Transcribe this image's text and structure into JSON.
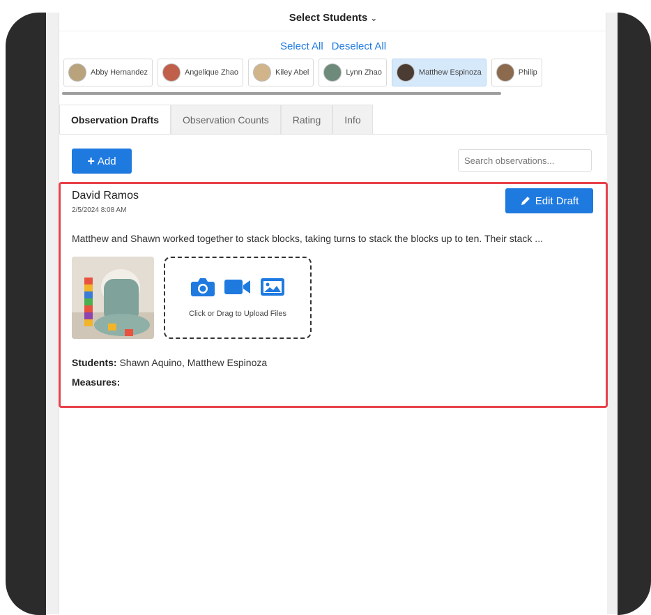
{
  "header": {
    "select_students_label": "Select Students",
    "chevron_icon": "chevron-down-icon"
  },
  "student_select": {
    "select_all": "Select All",
    "deselect_all": "Deselect All"
  },
  "students": [
    {
      "name": "Abby Hernandez",
      "selected": false,
      "avatar_color": "#b9a37c"
    },
    {
      "name": "Angelique Zhao",
      "selected": false,
      "avatar_color": "#c0604a"
    },
    {
      "name": "Kiley Abel",
      "selected": false,
      "avatar_color": "#d1b48a"
    },
    {
      "name": "Lynn Zhao",
      "selected": false,
      "avatar_color": "#6e8a7a"
    },
    {
      "name": "Matthew Espinoza",
      "selected": true,
      "avatar_color": "#4a3b33"
    },
    {
      "name": "Philip",
      "selected": false,
      "avatar_color": "#8b6a4e"
    }
  ],
  "tabs": [
    {
      "label": "Observation Drafts",
      "active": true
    },
    {
      "label": "Observation Counts",
      "active": false
    },
    {
      "label": "Rating",
      "active": false
    },
    {
      "label": "Info",
      "active": false
    }
  ],
  "toolbar": {
    "add_label": "Add",
    "search_placeholder": "Search observations..."
  },
  "draft": {
    "author": "David Ramos",
    "datetime": "2/5/2024 8:08 AM",
    "edit_label": "Edit Draft",
    "text": "Matthew and Shawn worked together to stack blocks, taking turns to stack the blocks up to ten. Their stack ...",
    "upload_label": "Click or Drag to Upload Files",
    "students_label": "Students:",
    "students_value": "Shawn Aquino, Matthew Espinoza",
    "measures_label": "Measures:",
    "measures_value": ""
  },
  "colors": {
    "accent": "#1f7ae0",
    "highlight_border": "#e8414b",
    "selected_chip": "#d6e9fb"
  }
}
